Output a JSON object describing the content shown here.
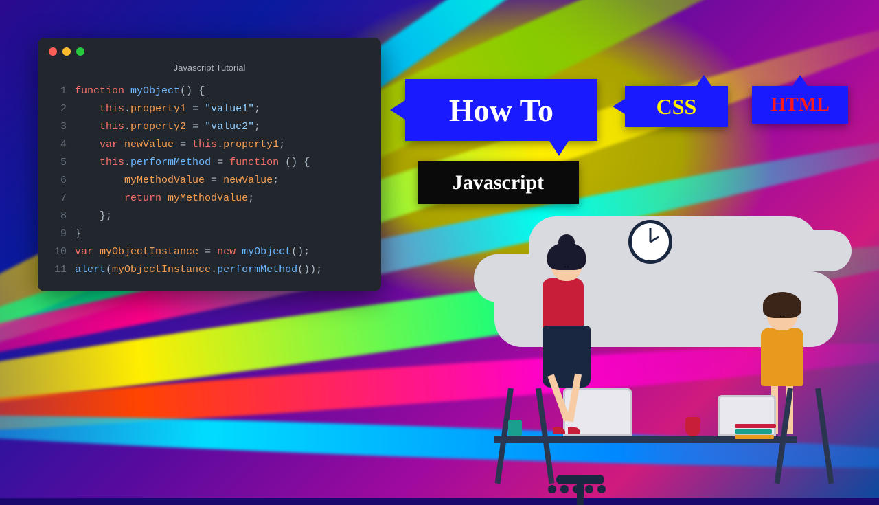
{
  "code_window": {
    "title": "Javascript Tutorial",
    "lines": [
      {
        "n": "1",
        "tokens": [
          [
            "kw",
            "function "
          ],
          [
            "fn",
            "myObject"
          ],
          [
            "pn",
            "() {"
          ]
        ]
      },
      {
        "n": "2",
        "tokens": [
          [
            "pn",
            "    "
          ],
          [
            "kw",
            "this"
          ],
          [
            "pn",
            "."
          ],
          [
            "prop",
            "property1"
          ],
          [
            "op",
            " = "
          ],
          [
            "str",
            "\"value1\""
          ],
          [
            "pn",
            ";"
          ]
        ]
      },
      {
        "n": "3",
        "tokens": [
          [
            "pn",
            "    "
          ],
          [
            "kw",
            "this"
          ],
          [
            "pn",
            "."
          ],
          [
            "prop",
            "property2"
          ],
          [
            "op",
            " = "
          ],
          [
            "str",
            "\"value2\""
          ],
          [
            "pn",
            ";"
          ]
        ]
      },
      {
        "n": "4",
        "tokens": [
          [
            "pn",
            "    "
          ],
          [
            "kw",
            "var"
          ],
          [
            "op",
            " "
          ],
          [
            "prop",
            "newValue"
          ],
          [
            "op",
            " = "
          ],
          [
            "kw",
            "this"
          ],
          [
            "pn",
            "."
          ],
          [
            "prop",
            "property1"
          ],
          [
            "pn",
            ";"
          ]
        ]
      },
      {
        "n": "5",
        "tokens": [
          [
            "pn",
            "    "
          ],
          [
            "kw",
            "this"
          ],
          [
            "pn",
            "."
          ],
          [
            "fn",
            "performMethod"
          ],
          [
            "op",
            " = "
          ],
          [
            "kw",
            "function"
          ],
          [
            "pn",
            " () {"
          ]
        ]
      },
      {
        "n": "6",
        "tokens": [
          [
            "pn",
            "        "
          ],
          [
            "prop",
            "myMethodValue"
          ],
          [
            "op",
            " = "
          ],
          [
            "prop",
            "newValue"
          ],
          [
            "pn",
            ";"
          ]
        ]
      },
      {
        "n": "7",
        "tokens": [
          [
            "pn",
            "        "
          ],
          [
            "kw",
            "return"
          ],
          [
            "op",
            " "
          ],
          [
            "prop",
            "myMethodValue"
          ],
          [
            "pn",
            ";"
          ]
        ]
      },
      {
        "n": "8",
        "tokens": [
          [
            "pn",
            "    };"
          ]
        ]
      },
      {
        "n": "9",
        "tokens": [
          [
            "pn",
            "}"
          ]
        ]
      },
      {
        "n": "10",
        "tokens": [
          [
            "kw",
            "var"
          ],
          [
            "op",
            " "
          ],
          [
            "prop",
            "myObjectInstance"
          ],
          [
            "op",
            " = "
          ],
          [
            "kw",
            "new"
          ],
          [
            "op",
            " "
          ],
          [
            "fn",
            "myObject"
          ],
          [
            "pn",
            "();"
          ]
        ]
      },
      {
        "n": "11",
        "tokens": [
          [
            "fn",
            "alert"
          ],
          [
            "pn",
            "("
          ],
          [
            "prop",
            "myObjectInstance"
          ],
          [
            "pn",
            "."
          ],
          [
            "fn",
            "performMethod"
          ],
          [
            "pn",
            "());"
          ]
        ]
      }
    ]
  },
  "tags": {
    "howto": "How To",
    "css": "CSS",
    "html": "HTML",
    "javascript": "Javascript"
  }
}
